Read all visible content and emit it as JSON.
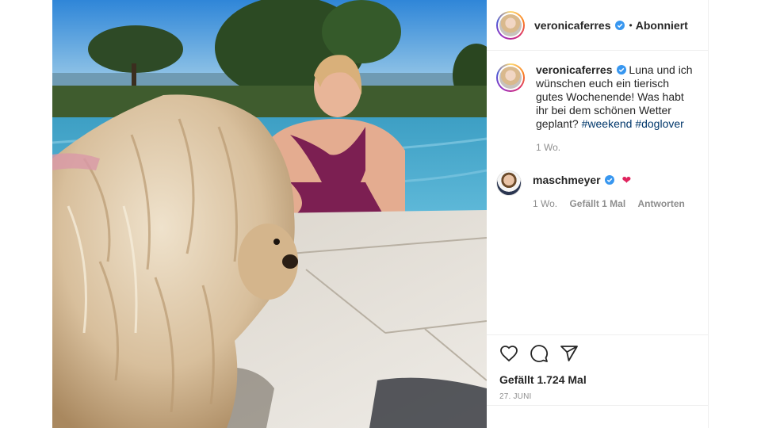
{
  "header": {
    "username": "veronicaferres",
    "follow_state": "Abonniert",
    "separator": "•"
  },
  "caption": {
    "username": "veronicaferres",
    "text": "Luna und ich wünschen euch ein tierisch gutes Wochenende! Was habt ihr bei dem schönen Wetter geplant?",
    "hashtags": [
      "#weekend",
      "#doglover"
    ],
    "time": "1 Wo."
  },
  "comment": {
    "username": "maschmeyer",
    "emoji": "❤",
    "time": "1 Wo.",
    "likes": "Gefällt 1 Mal",
    "reply": "Antworten"
  },
  "actions": {
    "icons": [
      "heart-icon",
      "comment-icon",
      "share-icon"
    ],
    "likes": "Gefällt 1.724 Mal",
    "date": "27. JUNI"
  },
  "colors": {
    "text": "#262626",
    "muted": "#8e8e8e",
    "hashtag": "#00376b",
    "verified": "#3897f0",
    "heart": "#e0245e",
    "border": "#efefef"
  }
}
